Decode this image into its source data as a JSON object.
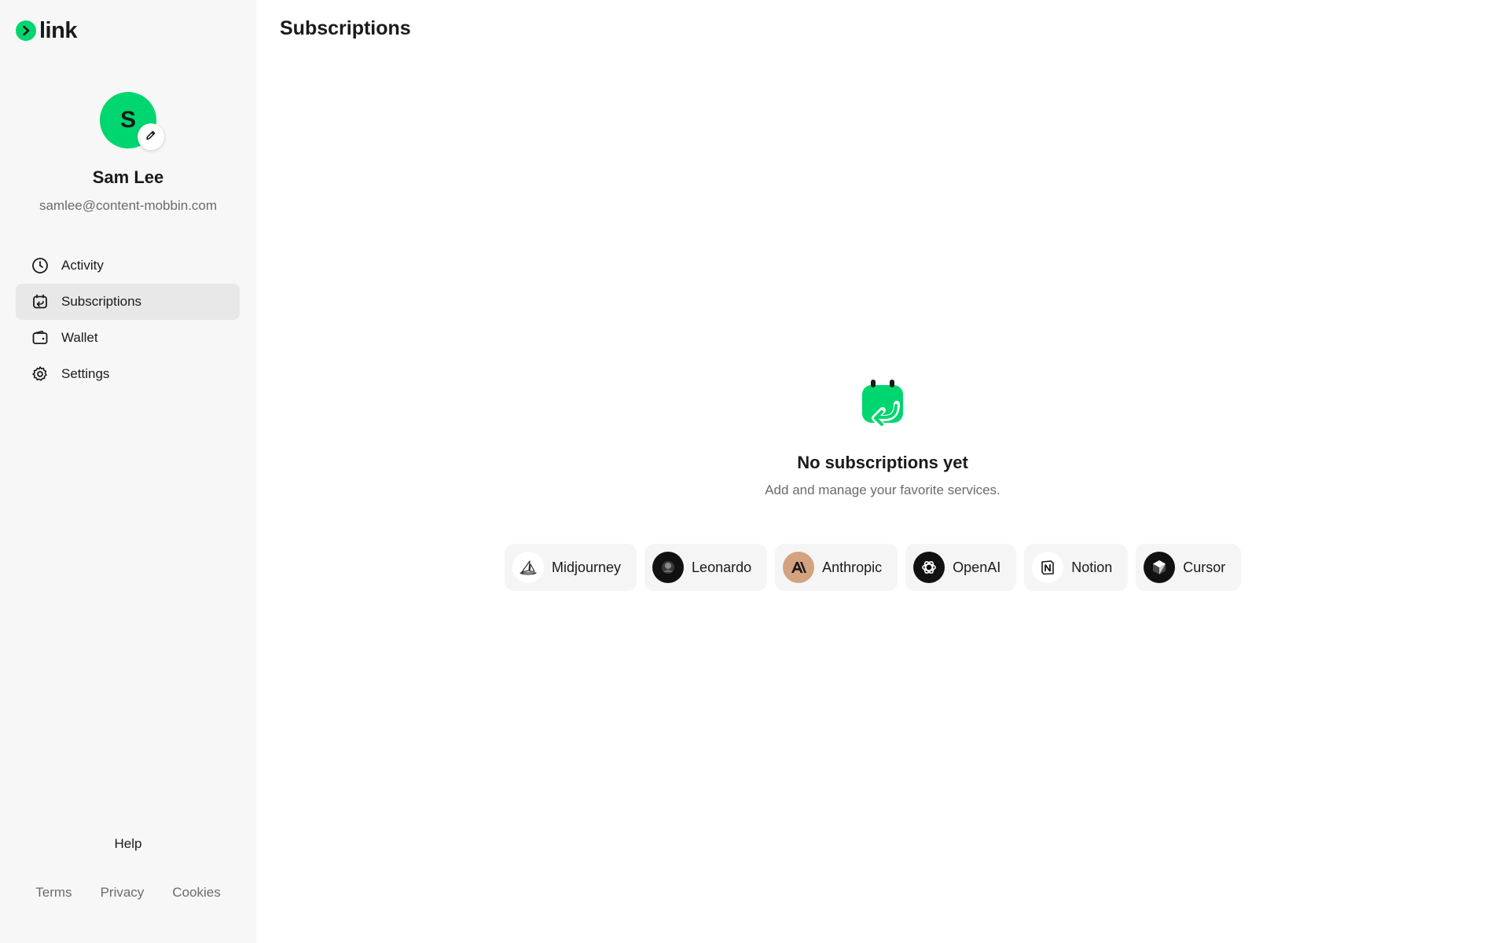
{
  "brand": {
    "name": "link",
    "accent": "#00d66f"
  },
  "user": {
    "initial": "S",
    "name": "Sam Lee",
    "email": "samlee@content-mobbin.com"
  },
  "nav": [
    {
      "label": "Activity",
      "icon": "clock-icon",
      "active": false
    },
    {
      "label": "Subscriptions",
      "icon": "calendar-return-icon",
      "active": true
    },
    {
      "label": "Wallet",
      "icon": "wallet-icon",
      "active": false
    },
    {
      "label": "Settings",
      "icon": "gear-icon",
      "active": false
    }
  ],
  "footer": {
    "help": "Help",
    "links": [
      "Terms",
      "Privacy",
      "Cookies"
    ]
  },
  "page": {
    "title": "Subscriptions"
  },
  "empty_state": {
    "icon": "calendar-return-icon",
    "title": "No subscriptions yet",
    "subtitle": "Add and manage your favorite services."
  },
  "services": [
    {
      "name": "Midjourney",
      "icon": "midjourney-logo-icon"
    },
    {
      "name": "Leonardo",
      "icon": "leonardo-logo-icon"
    },
    {
      "name": "Anthropic",
      "icon": "anthropic-logo-icon"
    },
    {
      "name": "OpenAI",
      "icon": "openai-logo-icon"
    },
    {
      "name": "Notion",
      "icon": "notion-logo-icon"
    },
    {
      "name": "Cursor",
      "icon": "cursor-logo-icon"
    }
  ]
}
